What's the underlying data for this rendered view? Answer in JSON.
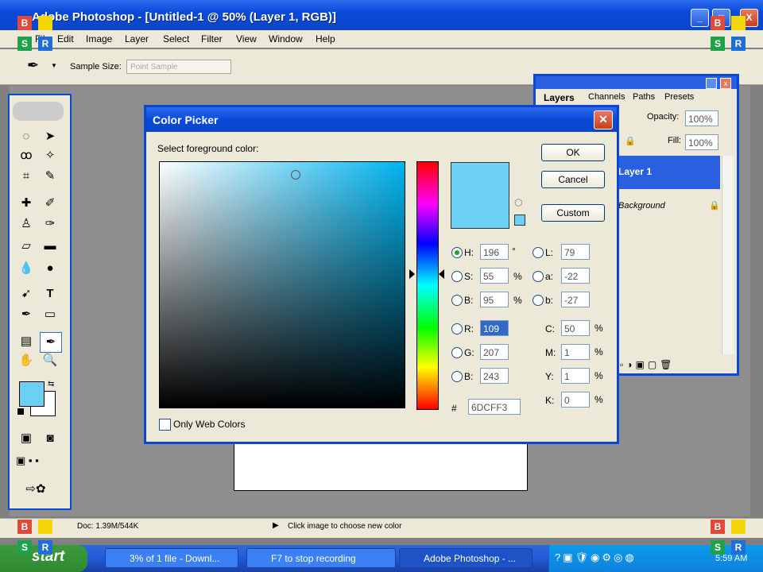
{
  "window": {
    "title": "Adobe Photoshop - [Untitled-1 @ 50% (Layer 1, RGB)]",
    "min": "_",
    "max": "□",
    "close": "X"
  },
  "menu": [
    "File",
    "Edit",
    "Image",
    "Layer",
    "Select",
    "Filter",
    "View",
    "Window",
    "Help"
  ],
  "options": {
    "sample_size_label": "Sample Size:",
    "sample_size_value": "Point Sample"
  },
  "status": {
    "doc": "Doc: 1.39M/544K",
    "hint": "Click image to choose new color"
  },
  "layers_palette": {
    "tabs": [
      "Layers",
      "Channels",
      "Paths",
      "Presets"
    ],
    "opacity_label": "Opacity:",
    "opacity_value": "100%",
    "fill_label": "Fill:",
    "fill_value": "100%",
    "layers": [
      "Layer 1",
      "Background"
    ]
  },
  "color_picker": {
    "title": "Color Picker",
    "prompt": "Select foreground color:",
    "ok": "OK",
    "cancel": "Cancel",
    "custom": "Custom",
    "selected_hex": "#6dcff3",
    "fields": {
      "H": {
        "label": "H:",
        "value": "196",
        "unit": "°"
      },
      "S": {
        "label": "S:",
        "value": "55",
        "unit": "%"
      },
      "B": {
        "label": "B:",
        "value": "95",
        "unit": "%"
      },
      "R": {
        "label": "R:",
        "value": "109"
      },
      "G": {
        "label": "G:",
        "value": "207"
      },
      "Bl": {
        "label": "B:",
        "value": "243"
      },
      "L": {
        "label": "L:",
        "value": "79"
      },
      "a": {
        "label": "a:",
        "value": "-22"
      },
      "b": {
        "label": "b:",
        "value": "-27"
      },
      "C": {
        "label": "C:",
        "value": "50",
        "unit": "%"
      },
      "M": {
        "label": "M:",
        "value": "1",
        "unit": "%"
      },
      "Y": {
        "label": "Y:",
        "value": "1",
        "unit": "%"
      },
      "K": {
        "label": "K:",
        "value": "0",
        "unit": "%"
      }
    },
    "hex_label": "#",
    "hex_value": "6DCFF3",
    "web_colors": "Only Web Colors"
  },
  "taskbar": {
    "start": "start",
    "tasks": [
      "3% of 1 file - Downl...",
      "F7 to stop recording",
      "Adobe Photoshop - ..."
    ],
    "clock": "5:59 AM"
  },
  "overlay_labels": {
    "r": "R",
    "b": "B",
    "s": "S"
  }
}
